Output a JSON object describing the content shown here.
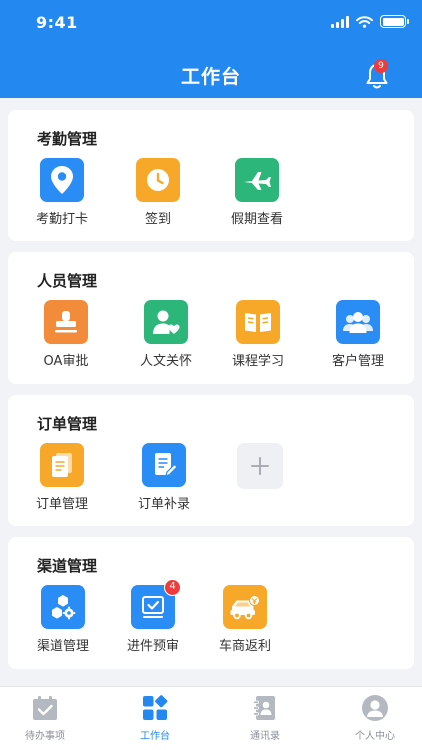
{
  "status_bar": {
    "time": "9:41"
  },
  "header": {
    "title": "工作台",
    "notification_count": "9"
  },
  "colors": {
    "primary": "#2389f0",
    "blue": "#2a8cf5",
    "orange": "#f7a829",
    "green": "#2db67a",
    "deep_orange": "#f28b3a",
    "badge_red": "#f23a3a"
  },
  "sections": [
    {
      "title": "考勤管理",
      "items": [
        {
          "label": "考勤打卡",
          "icon": "location-pin-icon"
        },
        {
          "label": "签到",
          "icon": "clock-icon"
        },
        {
          "label": "假期查看",
          "icon": "airplane-icon"
        }
      ]
    },
    {
      "title": "人员管理",
      "items": [
        {
          "label": "OA审批",
          "icon": "stamp-icon"
        },
        {
          "label": "人文关怀",
          "icon": "person-heart-icon"
        },
        {
          "label": "课程学习",
          "icon": "open-book-icon"
        },
        {
          "label": "客户管理",
          "icon": "people-group-icon"
        }
      ]
    },
    {
      "title": "订单管理",
      "items": [
        {
          "label": "订单管理",
          "icon": "document-list-icon"
        },
        {
          "label": "订单补录",
          "icon": "document-edit-icon"
        }
      ],
      "add_icon": "plus-icon"
    },
    {
      "title": "渠道管理",
      "items": [
        {
          "label": "渠道管理",
          "icon": "hexagon-gear-icon"
        },
        {
          "label": "进件预审",
          "icon": "checkbox-icon",
          "badge": "4"
        },
        {
          "label": "车商返利",
          "icon": "car-rebate-icon"
        }
      ]
    }
  ],
  "tabbar": {
    "active_tab": "工作台",
    "tabs": [
      {
        "label": "待办事项",
        "icon": "calendar-check-icon"
      },
      {
        "label": "工作台",
        "icon": "workbench-grid-icon"
      },
      {
        "label": "通讯录",
        "icon": "address-book-icon"
      },
      {
        "label": "个人中心",
        "icon": "user-avatar-icon"
      }
    ]
  }
}
